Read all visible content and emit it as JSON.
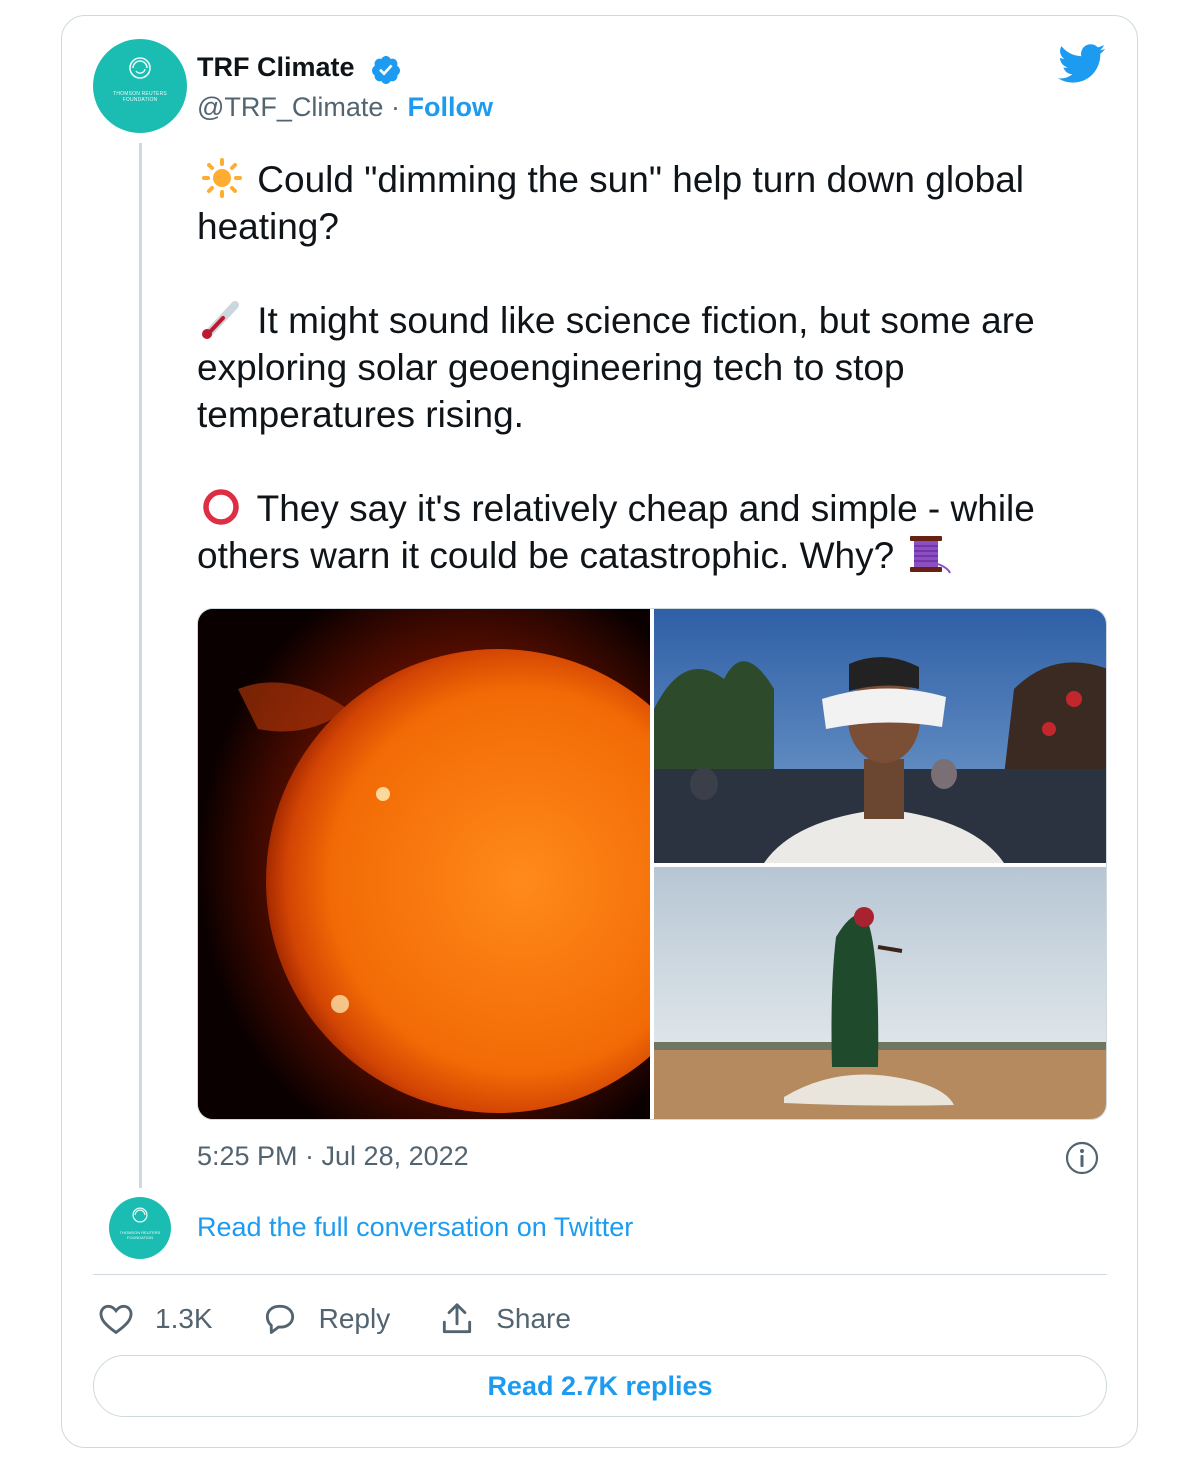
{
  "author": {
    "name": "TRF Climate",
    "handle": "@TRF_Climate",
    "separator": "·",
    "follow_label": "Follow",
    "avatar_org_text": "THOMSON REUTERS FOUNDATION"
  },
  "tweet": {
    "line1": "Could \"dimming the sun\" help turn down global heating?",
    "line2": "It might sound like science fiction, but some are exploring solar geoengineering tech to stop temperatures rising.",
    "line3": "They say it's relatively cheap and simple - while others warn it could be catastrophic. Why?",
    "emoji_icons": [
      "sun-emoji",
      "thermometer-emoji",
      "red-circle-emoji",
      "thread-spool-emoji"
    ]
  },
  "media": {
    "images": [
      "sun-photo",
      "eclipse-glasses-photo",
      "drought-photo"
    ]
  },
  "timestamp": "5:25 PM · Jul 28, 2022",
  "read_conversation": "Read the full conversation on Twitter",
  "actions": {
    "likes": "1.3K",
    "reply_label": "Reply",
    "share_label": "Share"
  },
  "read_replies": "Read 2.7K replies",
  "colors": {
    "accent": "#1d9bf0",
    "avatar": "#1bbcb1",
    "secondary_text": "#536471",
    "border": "#cfd9de"
  }
}
